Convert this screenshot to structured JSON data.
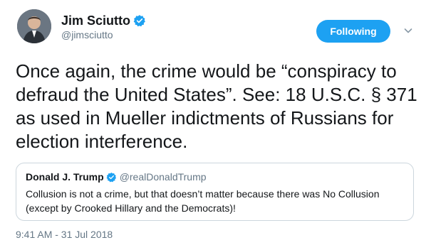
{
  "author": {
    "name": "Jim Sciutto",
    "handle": "@jimsciutto",
    "avatar_icon": "person-avatar",
    "verified_icon": "verified-badge-icon"
  },
  "follow_button": {
    "label": "Following",
    "color": "#1da1f2"
  },
  "menu_icon": "chevron-down-icon",
  "tweet": {
    "text": "Once again, the crime would be “conspiracy to defraud the United States”. See: 18 U.S.C. § 371 as used in Mueller indictments of Russians for election interference."
  },
  "quoted_tweet": {
    "name": "Donald J. Trump",
    "handle": "@realDonaldTrump",
    "text": "Collusion is not a crime, but that doesn’t matter because there was No Collusion (except by Crooked Hillary and the Democrats)!"
  },
  "timestamp": "9:41 AM - 31 Jul 2018"
}
